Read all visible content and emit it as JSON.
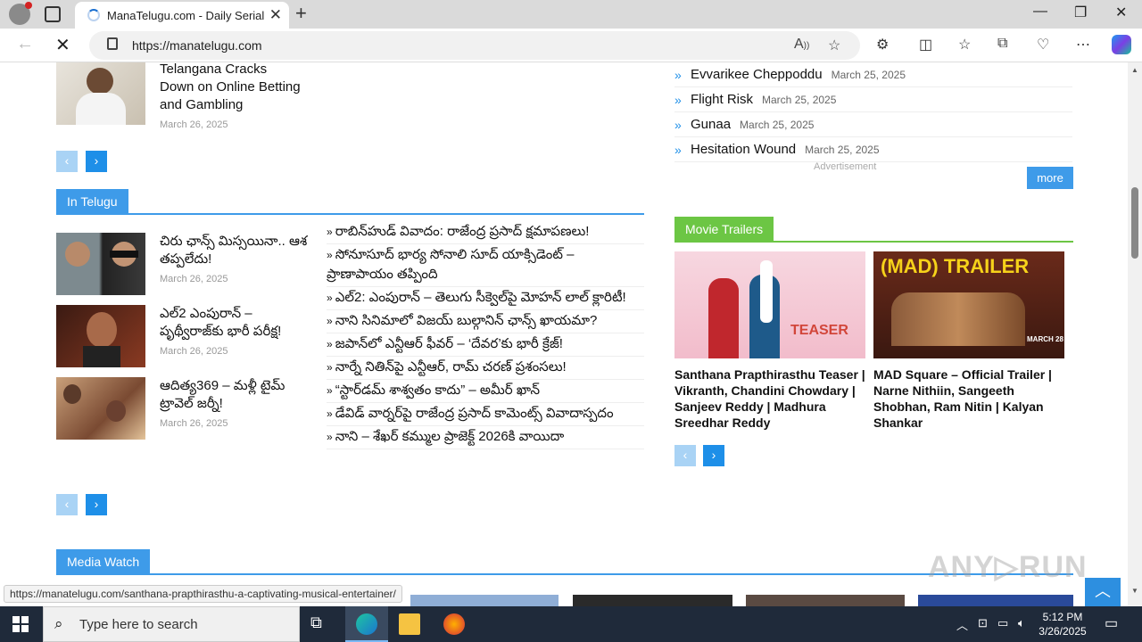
{
  "browser": {
    "tab_title": "ManaTelugu.com - Daily Serials | ",
    "url": "https://manatelugu.com",
    "new_tab": "+",
    "tab_close": "✕"
  },
  "top_article": {
    "title": "Telangana Cracks Down on Online Betting and Gambling",
    "date": "March 26, 2025"
  },
  "sections": {
    "telugu": "In Telugu",
    "trailers": "Movie Trailers",
    "media": "Media Watch"
  },
  "telugu_articles": [
    {
      "title": "చిరు ఛాన్స్ మిస్సయినా.. ఆశ తప్పలేదు!",
      "date": "March 26, 2025"
    },
    {
      "title": "ఎల్2 ఎంపురాన్ – పృథ్వీరాజ్‌కు భారీ పరీక్ష!",
      "date": "March 26, 2025"
    },
    {
      "title": "ఆదిత్య369 – మళ్లీ టైమ్ ట్రావెల్ జర్నీ!",
      "date": "March 26, 2025"
    }
  ],
  "telugu_links": [
    "రాబిన్‌హుడ్ వివాదం: రాజేంద్ర ప్రసాద్ క్షమాపణలు!",
    "సోనూసూద్ భార్య సోనాలి సూద్ యాక్సిడెంట్ – ప్రాణాపాయం తప్పింది",
    "ఎల్2: ఎంపురాన్ – తెలుగు సీక్వెల్‌పై మోహన్ లాల్ క్లారిటీ!",
    "నాని సినిమాలో విజయ్ బుల్గానిన్ ఛాన్స్ ఖాయమా?",
    "జపాన్‌లో ఎన్టీఆర్ ఫీవర్ – ‘దేవర’కు భారీ క్రేజ్!",
    "నార్నే నితిన్‌పై ఎన్టీఆర్, రామ్ చరణ్ ప్రశంసలు!",
    "“స్టార్‌డమ్ శాశ్వతం కాదు” – అమీర్ ఖాన్",
    "డేవిడ్ వార్నర్‌పై రాజేంద్ర ప్రసాద్ కామెంట్స్ వివాదాస్పదం",
    "నాని – శేఖర్ కమ్ముల ప్రాజెక్ట్ 2026కి వాయిదా"
  ],
  "movies": [
    {
      "title": "Evvarikee Cheppoddu",
      "date": "March 25, 2025"
    },
    {
      "title": "Flight Risk",
      "date": "March 25, 2025"
    },
    {
      "title": "Gunaa",
      "date": "March 25, 2025"
    },
    {
      "title": "Hesitation Wound",
      "date": "March 25, 2025"
    }
  ],
  "advertisement": "Advertisement",
  "more": "more",
  "trailers": [
    {
      "title": "Santhana Prapthirasthu Teaser | Vikranth, Chandini Chowdary | Sanjeev Reddy | Madhura Sreedhar Reddy",
      "thumb_text": "TEASER"
    },
    {
      "title": "MAD Square – Official Trailer | Narne Nithiin, Sangeeth Shobhan, Ram Nitin | Kalyan Shankar",
      "thumb_text": "(MAD) TRAILER",
      "thumb_sub": "MARCH 28"
    }
  ],
  "pager": {
    "prev": "‹",
    "next": "›"
  },
  "status_url": "https://manatelugu.com/santhana-prapthirasthu-a-captivating-musical-entertainer/",
  "watermark": "ANY▷RUN",
  "taskbar": {
    "search_placeholder": "Type here to search",
    "time": "5:12 PM",
    "date": "3/26/2025"
  },
  "colors": {
    "accent_blue": "#1e8fe8",
    "section_blue": "#3e9be9",
    "trailer_green": "#6cc644",
    "taskbar": "#1f2a3a"
  }
}
